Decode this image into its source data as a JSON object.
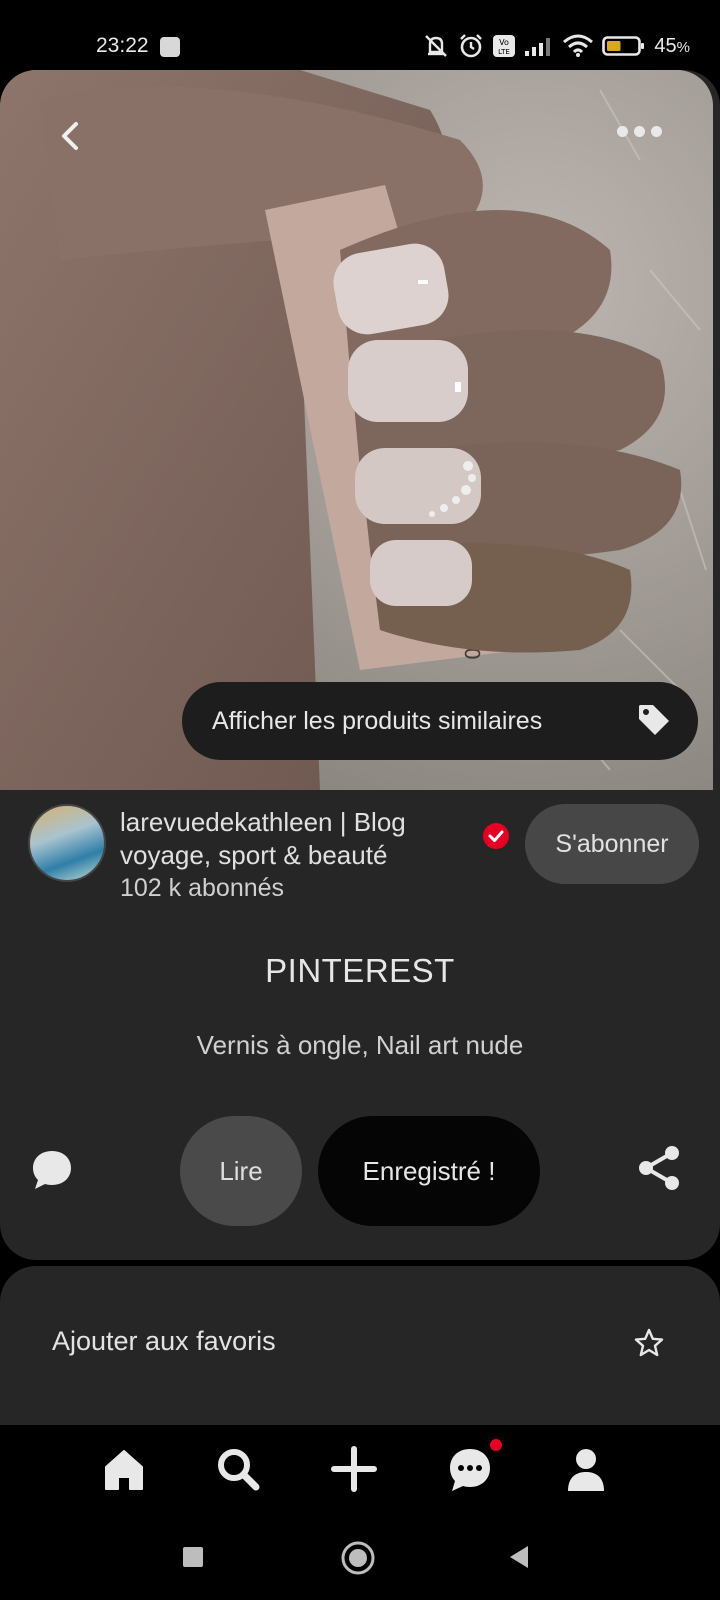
{
  "status_bar": {
    "time": "23:22",
    "battery_percent": "45",
    "battery_unit": "%",
    "icons": [
      "mute-icon",
      "alarm-icon",
      "volte-icon",
      "signal-icon",
      "wifi-icon",
      "battery-icon"
    ],
    "battery_level": 0.45
  },
  "pin": {
    "similar_products_label": "Afficher les produits similaires",
    "author": {
      "name": "larevuedekathleen | Blog voyage, sport & beauté",
      "followers": "102 k abonnés",
      "verified": true
    },
    "follow_label": "S'abonner",
    "title": "PINTEREST",
    "description": "Vernis à ongle, Nail art nude",
    "read_label": "Lire",
    "saved_label": "Enregistré !"
  },
  "options": {
    "favorites_label": "Ajouter aux favoris"
  },
  "bottom_nav": {
    "items": [
      "home-icon",
      "search-icon",
      "create-icon",
      "messages-icon",
      "profile-icon"
    ],
    "messages_has_notification": true
  },
  "colors": {
    "accent": "#e60023",
    "card_bg": "#262626",
    "background": "#000000"
  }
}
